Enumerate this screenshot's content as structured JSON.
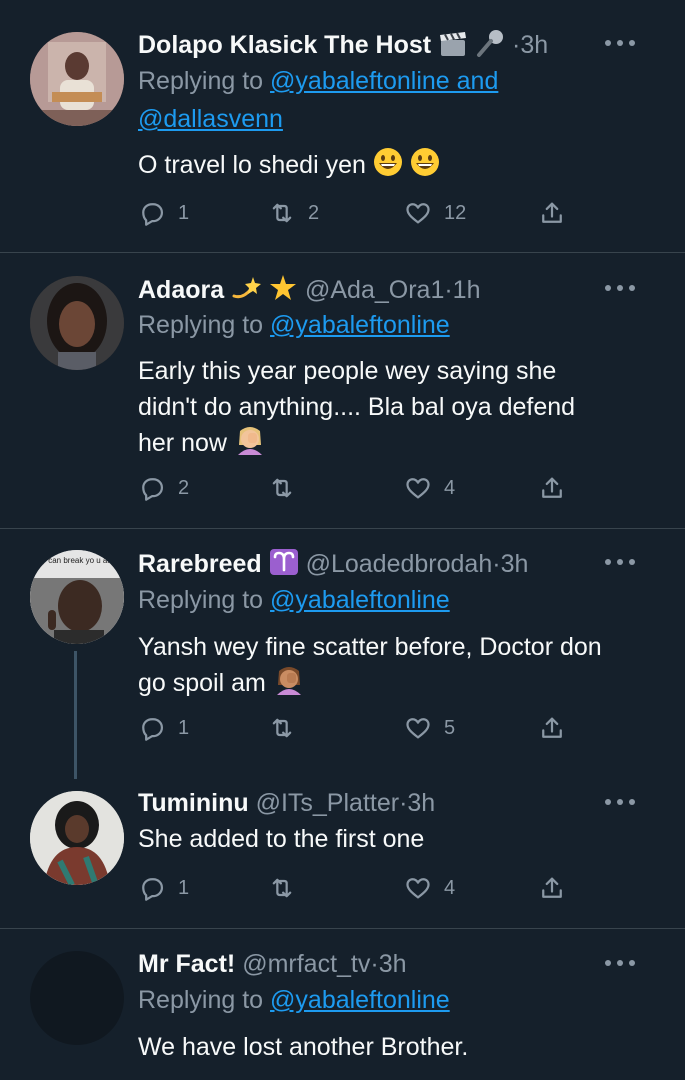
{
  "tweets": [
    {
      "name": "Dolapo Klasick The Host",
      "handle": "",
      "time": "3h",
      "replying_prefix": "Replying to ",
      "replying_link": "@yabaleftonline and",
      "replying_link_2": "@dallasvenn",
      "text": "O travel lo shedi yen",
      "counts": {
        "reply": "1",
        "retweet": "2",
        "like": "12"
      }
    },
    {
      "name": "Adaora",
      "handle": "@Ada_Ora1",
      "time": "1h",
      "replying_prefix": "Replying to ",
      "replying_link": "@yabaleftonline",
      "text_lines": [
        "Early this year people wey saying she",
        "didn't do anything.... Bla bal oya defend",
        "her now"
      ],
      "counts": {
        "reply": "2",
        "retweet": "",
        "like": "4"
      }
    },
    {
      "name": "Rarebreed",
      "handle": "@Loadedbrodah",
      "time": "3h",
      "replying_prefix": "Replying to ",
      "replying_link": "@yabaleftonline",
      "text_lines": [
        "Yansh wey fine scatter before, Doctor don",
        "go spoil am"
      ],
      "avatar_caption": "y can break yo u are single",
      "counts": {
        "reply": "1",
        "retweet": "",
        "like": "5"
      }
    },
    {
      "name": "Tumininu",
      "handle": "@ITs_Platter",
      "time": "3h",
      "text": "She added to the first one",
      "counts": {
        "reply": "1",
        "retweet": "",
        "like": "4"
      }
    },
    {
      "name": "Mr Fact!",
      "handle": "@mrfact_tv",
      "time": "3h",
      "replying_prefix": "Replying to ",
      "replying_link": "@yabaleftonline",
      "text": "We have lost another Brother."
    }
  ],
  "dot": "·",
  "colors": {
    "background": "#15202b",
    "text": "#f7f9f9",
    "muted": "#8b98a5",
    "link": "#1d9bf0",
    "divider": "#38444d"
  },
  "icons": [
    "reply-icon",
    "retweet-icon",
    "like-icon",
    "share-icon",
    "more-icon",
    "clapper-icon",
    "microphone-icon",
    "grinning-face-icon",
    "dizzy-icon",
    "glowing-star-icon",
    "aries-icon",
    "facepalm-icon"
  ]
}
